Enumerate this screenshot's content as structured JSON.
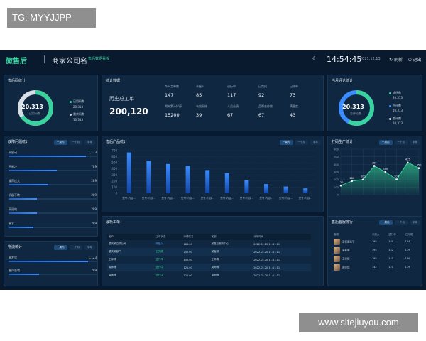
{
  "watermark_top": "TG: MYYJJPP",
  "watermark_bottom": "www.sitejiuyou.com",
  "header": {
    "logo": "微售后",
    "company": "商家公司名",
    "badge": "售后数据看板",
    "clock": "14:54:45",
    "date": "2021.12.13",
    "refresh": "刷新",
    "exit": "退出"
  },
  "after_sales": {
    "title": "售后码统计",
    "donut_value": "20,313",
    "donut_label": "已用码数",
    "legend": [
      {
        "label": "已用码数",
        "value": "20,313",
        "color": "#3ad29f"
      },
      {
        "label": "剩余码数",
        "value": "10,313",
        "color": "#c8d2dd"
      }
    ],
    "ratio": 0.66
  },
  "staff": {
    "title": "统计数据",
    "total_label": "历史总工单",
    "total_value": "200,120",
    "stats": [
      {
        "k": "今天工单数",
        "v": "147"
      },
      {
        "k": "未接入",
        "v": "85"
      },
      {
        "k": "进行中",
        "v": "117"
      },
      {
        "k": "已完成",
        "v": "92"
      },
      {
        "k": "已结单",
        "v": "73"
      },
      {
        "k": "期末累计好评",
        "v": "15200"
      },
      {
        "k": "有效报修",
        "v": "39"
      },
      {
        "k": "人员业绩",
        "v": "67"
      },
      {
        "k": "品牌合作数",
        "v": "67"
      },
      {
        "k": "满意度",
        "v": "43"
      }
    ]
  },
  "review": {
    "title": "当月评论统计",
    "donut_value": "20,313",
    "donut_label": "总评论数",
    "legend": [
      {
        "label": "好评数",
        "value": "20,313",
        "color": "#3ad29f"
      },
      {
        "label": "中评数",
        "value": "10,313",
        "color": "#3a8cff"
      },
      {
        "label": "差评数",
        "value": "10,313",
        "color": "#c8d2dd"
      }
    ]
  },
  "faults": {
    "title": "故障问题统计",
    "tabs": [
      "一周内",
      "一个月",
      "半年"
    ],
    "rows": [
      {
        "label": "不启动",
        "value": "1,123",
        "fraction": 0.88
      },
      {
        "label": "不制冷",
        "value": "789",
        "fraction": 0.55
      },
      {
        "label": "噪声过大",
        "value": "289",
        "fraction": 0.45
      },
      {
        "label": "机器不转",
        "value": "289",
        "fraction": 0.32
      },
      {
        "label": "不通电",
        "value": "289",
        "fraction": 0.32
      },
      {
        "label": "漏水",
        "value": "289",
        "fraction": 0.28
      }
    ]
  },
  "logistics": {
    "title": "物流统计",
    "tabs": [
      "一周内",
      "一个月",
      "半年"
    ],
    "rows": [
      {
        "label": "未发货",
        "value": "1,123",
        "fraction": 0.9
      },
      {
        "label": "客户签收",
        "value": "789",
        "fraction": 0.35
      }
    ]
  },
  "products": {
    "title": "售后产品统计",
    "tabs": [
      "一周内",
      "一个月",
      "半年"
    ]
  },
  "orders": {
    "title": "最新工单",
    "columns": [
      "客户",
      "工单状态",
      "师傅姓名",
      "客服",
      "派单时间"
    ],
    "rows": [
      {
        "customer": "重庆某空调公司…",
        "status": "待接入",
        "tech": "188.00",
        "service": "某售后服务中心",
        "time": "2022.02.20 11:11:11",
        "status_color": "#6fb0ff"
      },
      {
        "customer": "重庆某客户",
        "status": "已完成",
        "tech": "142.00",
        "service": "某客服",
        "time": "2022.02.20 11:11:11",
        "status_color": "#37d49a"
      },
      {
        "customer": "王师傅",
        "status": "进行中",
        "tech": "145.00",
        "service": "王师傅",
        "time": "2022.02.20 11:11:11",
        "status_color": "#37d49a"
      },
      {
        "customer": "周师傅",
        "status": "进行中",
        "tech": "121.00",
        "service": "周师傅",
        "time": "2022.02.20 11:11:11",
        "status_color": "#37d49a"
      },
      {
        "customer": "周师傅",
        "status": "进行中",
        "tech": "121.00",
        "service": "周师傅",
        "time": "2022.02.20 11:11:11",
        "status_color": "#37d49a"
      }
    ]
  },
  "printer": {
    "title": "打码生产统计",
    "tabs": [
      "一周内",
      "一个月",
      "半年"
    ]
  },
  "service_rank": {
    "title": "售后客服排行",
    "tabs": [
      "一周内",
      "一个月",
      "半年"
    ],
    "columns": [
      "客服",
      "未接入",
      "进行中",
      "已完成"
    ],
    "rows": [
      {
        "name": "某客服名字",
        "a": "195",
        "b": "180",
        "c": "194"
      },
      {
        "name": "某客服",
        "a": "195",
        "b": "142",
        "c": "179"
      },
      {
        "name": "王师傅",
        "a": "195",
        "b": "145",
        "c": "180"
      },
      {
        "name": "周师傅",
        "a": "142",
        "b": "121",
        "c": "179"
      }
    ]
  },
  "chart_data": [
    {
      "type": "bar",
      "title": "售后产品统计",
      "categories": [
        "型号:内容…",
        "型号:内容…",
        "型号:内容…",
        "型号:内容…",
        "型号:内容…",
        "型号:内容…",
        "型号:内容…",
        "型号:内容…",
        "型号:内容…",
        "型号:内容…"
      ],
      "values": [
        670,
        530,
        480,
        450,
        380,
        330,
        210,
        150,
        110,
        80
      ],
      "ylim": [
        0,
        700
      ],
      "yticks": [
        0,
        100,
        200,
        300,
        400,
        500,
        600,
        700
      ],
      "grid": true
    },
    {
      "type": "area",
      "title": "打码生产统计",
      "categories": [
        "",
        "",
        "",
        "",
        "",
        "",
        "",
        ""
      ],
      "values": [
        120,
        180,
        200,
        380,
        300,
        200,
        425,
        350
      ],
      "labels": [
        "120",
        "180",
        "200",
        "380",
        "300",
        "200",
        "425",
        "350"
      ],
      "ylim": [
        0,
        600
      ],
      "yticks": [
        0,
        100,
        200,
        300,
        400,
        500,
        600
      ],
      "grid": true
    }
  ]
}
